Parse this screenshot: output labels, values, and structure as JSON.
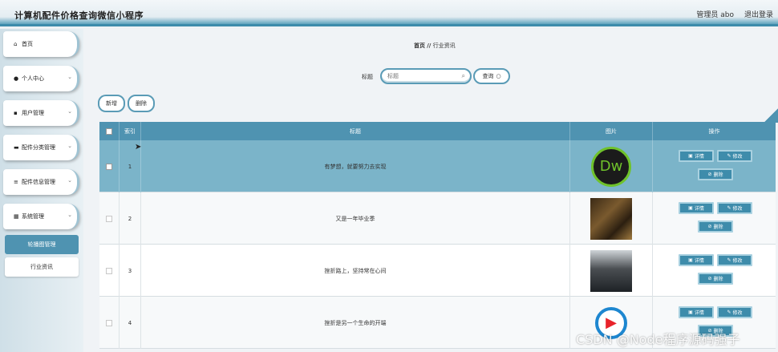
{
  "header": {
    "title": "计算机配件价格查询微信小程序",
    "user": "管理员 abo",
    "logout": "退出登录"
  },
  "sidebar": {
    "items": [
      {
        "icon": "home-icon",
        "label": "首页"
      },
      {
        "icon": "user-icon",
        "label": "个人中心"
      },
      {
        "icon": "grid-icon",
        "label": "用户管理"
      },
      {
        "icon": "comment-icon",
        "label": "配件分类管理"
      },
      {
        "icon": "list-icon",
        "label": "配件信息管理"
      },
      {
        "icon": "table-icon",
        "label": "系统管理"
      }
    ],
    "subitems": [
      {
        "label": "轮播图管理",
        "active": true
      },
      {
        "label": "行业资讯",
        "active": false
      }
    ]
  },
  "breadcrumb": {
    "home": "首页",
    "sep": "//",
    "current": "行业资讯"
  },
  "search": {
    "label": "标题",
    "placeholder": "标题",
    "button": "查询"
  },
  "actions": {
    "add": "新增",
    "delete": "删除"
  },
  "table": {
    "columns": {
      "index": "索引",
      "title": "标题",
      "image": "图片",
      "ops": "操作"
    },
    "op_labels": {
      "detail": "详情",
      "edit": "修改",
      "delete": "删除"
    },
    "rows": [
      {
        "index": "1",
        "title": "有梦想，就要努力去实现",
        "image": "dreamweaver-logo",
        "selected": true
      },
      {
        "index": "2",
        "title": "又是一年毕业季",
        "image": "photo-room"
      },
      {
        "index": "3",
        "title": "挫折路上，坚持常在心间",
        "image": "photo-office"
      },
      {
        "index": "4",
        "title": "挫折是另一个生命的开端",
        "image": "play-logo"
      }
    ]
  },
  "watermark": "CSDN @Node程序源码强子",
  "colors": {
    "accent": "#4f93b1",
    "selected_row": "#7bb4c9",
    "button": "#3e8cab"
  }
}
